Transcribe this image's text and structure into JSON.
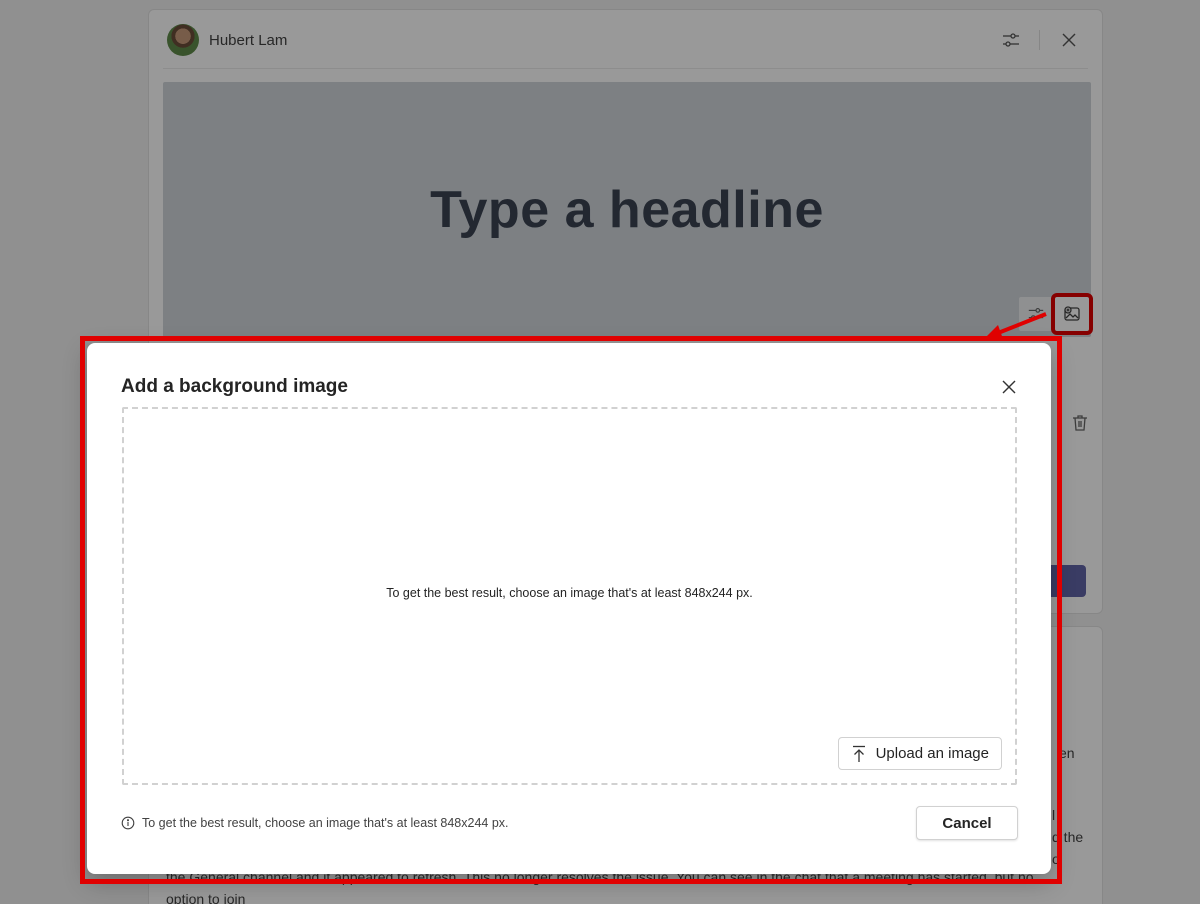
{
  "author": {
    "name": "Hubert Lam"
  },
  "banner": {
    "headline_placeholder": "Type a headline"
  },
  "post": {
    "line1": "the General channel and it appeared to refresh. This no longer resolves the issue. You can see in the chat that a meeting has started, but no",
    "line2": "option to join",
    "frag_en": "en",
    "frag_d_the": "d the",
    "frag_l": "l",
    "frag_o": "o"
  },
  "dialog": {
    "title": "Add a background image",
    "dropzone_hint": "To get the best result, choose an image that's at least 848x244 px.",
    "upload_label": "Upload an image",
    "footer_info": "To get the best result, choose an image that's at least 848x244 px.",
    "cancel_label": "Cancel"
  },
  "colors": {
    "annotation": "#e00000",
    "primary_button": "#6264a7",
    "banner_bg": "#d0d5db"
  }
}
